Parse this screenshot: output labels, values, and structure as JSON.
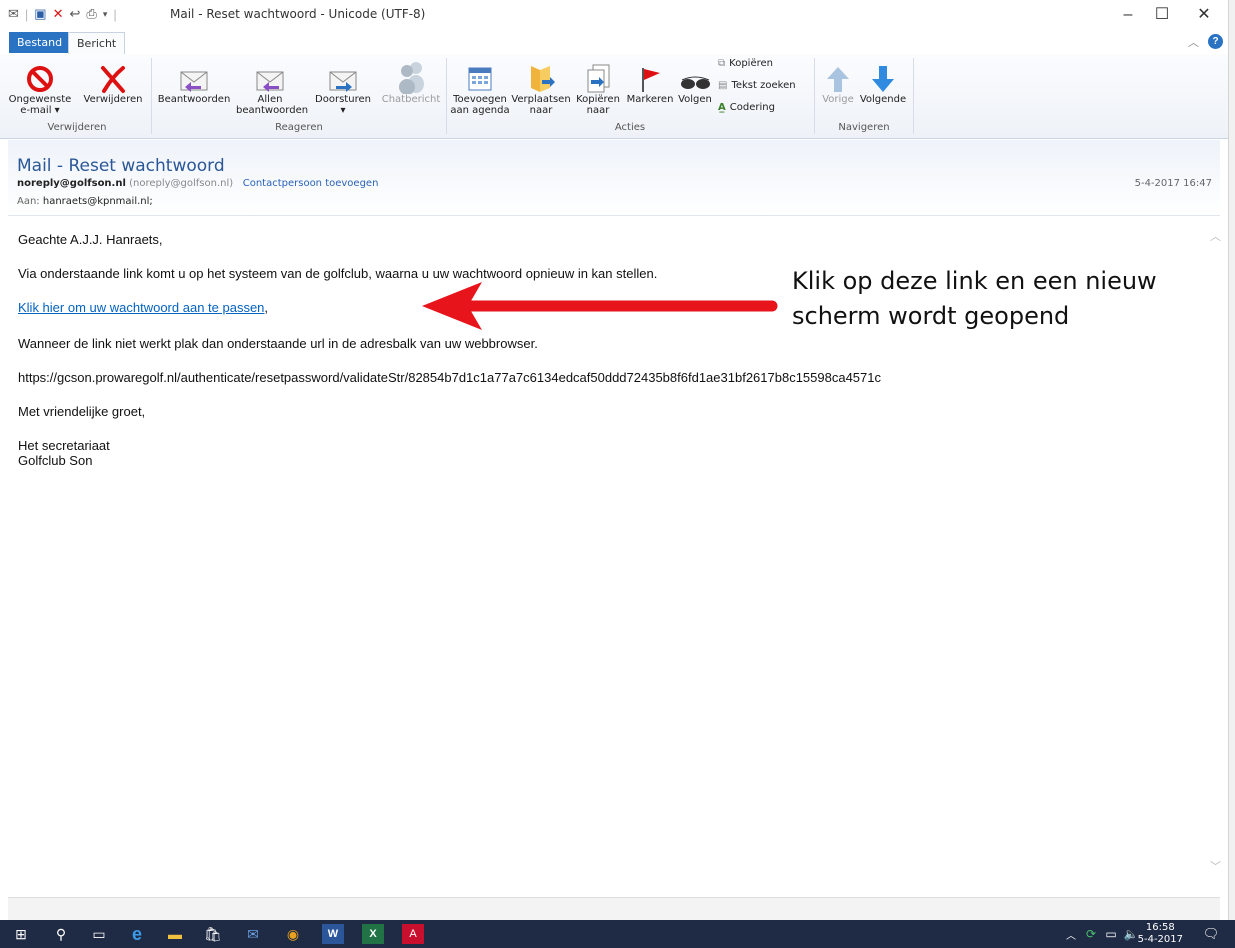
{
  "window": {
    "title": "Mail - Reset wachtwoord  -  Unicode (UTF-8)"
  },
  "tabs": {
    "file": "Bestand",
    "message": "Bericht"
  },
  "ribbon": {
    "junk_line1": "Ongewenste",
    "junk_line2": "e-mail",
    "delete": "Verwijderen",
    "group_delete": "Verwijderen",
    "reply": "Beantwoorden",
    "reply_all_line1": "Allen",
    "reply_all_line2": "beantwoorden",
    "forward": "Doorsturen",
    "chat": "Chatbericht",
    "group_reply": "Reageren",
    "add_calendar_line1": "Toevoegen",
    "add_calendar_line2": "aan agenda",
    "move_line1": "Verplaatsen",
    "move_line2": "naar",
    "copy_line1": "Kopiëren",
    "copy_line2": "naar",
    "mark": "Markeren",
    "follow": "Volgen",
    "copy_small": "Kopiëren",
    "find_text": "Tekst zoeken",
    "encoding": "Codering",
    "group_actions": "Acties",
    "previous": "Vorige",
    "next": "Volgende",
    "group_navigate": "Navigeren"
  },
  "message": {
    "subject": "Mail - Reset wachtwoord",
    "from_address": "noreply@golfson.nl",
    "from_paren": "(noreply@golfson.nl)",
    "add_contact": "Contactpersoon toevoegen",
    "to_label": "Aan:",
    "to_address": "hanraets@kpnmail.nl;",
    "date": "5-4-2017 16:47"
  },
  "body": {
    "greeting": "Geachte A.J.J. Hanraets,",
    "line1": "Via onderstaande link komt u op het systeem van de golfclub, waarna u uw wachtwoord opnieuw in kan stellen.",
    "link_text": "Klik hier om uw wachtwoord aan te passen",
    "link_suffix": ",",
    "line2": "Wanneer de link niet werkt plak dan onderstaande url in de adresbalk van uw webbrowser.",
    "url": "https://gcson.prowaregolf.nl/authenticate/resetpassword/validateStr/82854b7d1c1a77a7c6134edcaf50ddd72435b8f6fd1ae31bf2617b8c15598ca4571c",
    "closing": "Met vriendelijke groet,",
    "sig1": "Het secretariaat",
    "sig2": "Golfclub Son"
  },
  "annotation": {
    "line1": "Klik op deze link en een nieuw",
    "line2": "scherm wordt geopend",
    "arrow_color": "#e8141b"
  },
  "taskbar": {
    "time": "16:58",
    "date": "5-4-2017"
  }
}
